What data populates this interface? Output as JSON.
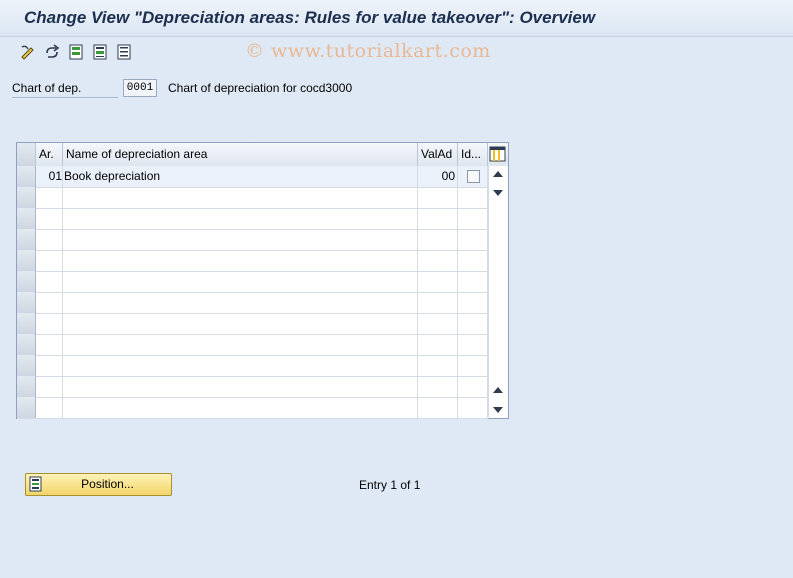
{
  "window": {
    "title": "Change View \"Depreciation areas: Rules for value takeover\": Overview"
  },
  "watermark": "© www.tutorialkart.com",
  "toolbar": {
    "buttons": [
      "display-change-icon",
      "other-view-icon",
      "select-all-icon",
      "select-block-icon",
      "deselect-all-icon"
    ]
  },
  "chart_of_dep": {
    "label": "Chart of dep.",
    "value": "0001",
    "description": "Chart of depreciation for cocd3000"
  },
  "table": {
    "columns": [
      "Ar.",
      "Name of depreciation area",
      "ValAd",
      "Id..."
    ],
    "rows": [
      {
        "area": "01",
        "name": "Book depreciation",
        "valad": "00",
        "identical": false
      }
    ],
    "empty_rows": 11
  },
  "position_button": {
    "label": "Position..."
  },
  "entry_text": "Entry 1 of 1",
  "colors": {
    "title": "#1c2f4e",
    "background": "#dfe9f5",
    "button": "#f2d46a"
  }
}
